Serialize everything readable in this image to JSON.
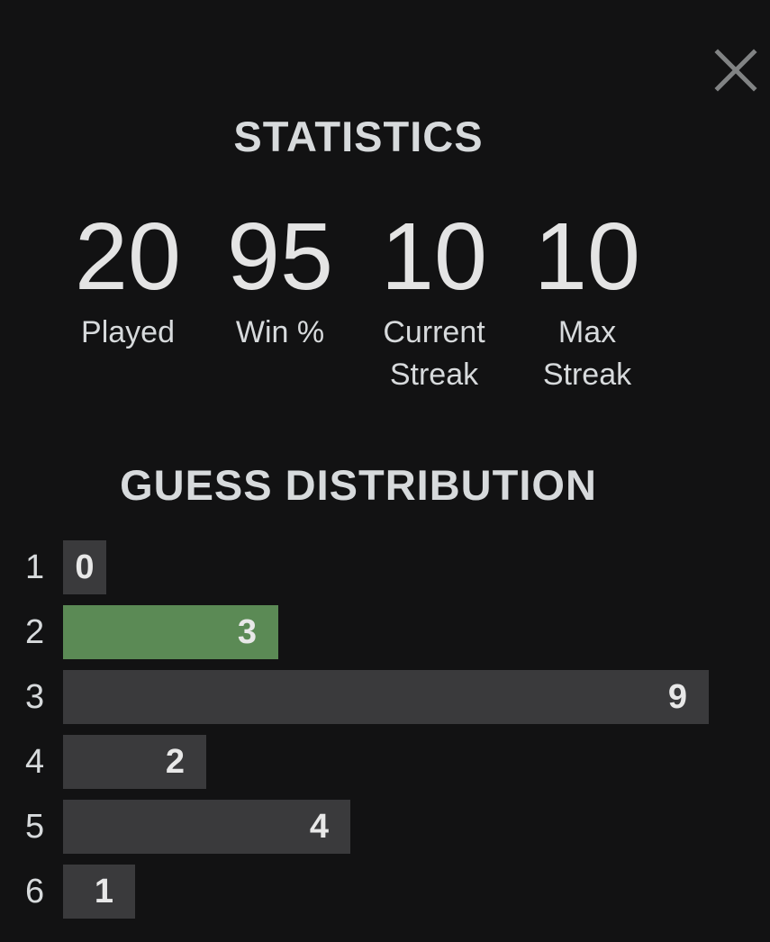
{
  "modal": {
    "close_icon": "close-icon",
    "statistics_title": "STATISTICS",
    "distribution_title": "GUESS DISTRIBUTION"
  },
  "stats": [
    {
      "value": "20",
      "label_line1": "Played",
      "label_line2": ""
    },
    {
      "value": "95",
      "label_line1": "Win %",
      "label_line2": ""
    },
    {
      "value": "10",
      "label_line1": "Current",
      "label_line2": "Streak"
    },
    {
      "value": "10",
      "label_line1": "Max",
      "label_line2": "Streak"
    }
  ],
  "colors": {
    "background": "#121213",
    "bar": "#3a3a3c",
    "bar_highlight": "#5b8a55",
    "text": "#d7dadc"
  },
  "distribution": {
    "max": 9,
    "highlight_guess": "2",
    "rows": [
      {
        "guess": "1",
        "count": 0
      },
      {
        "guess": "2",
        "count": 3
      },
      {
        "guess": "3",
        "count": 9
      },
      {
        "guess": "4",
        "count": 2
      },
      {
        "guess": "5",
        "count": 4
      },
      {
        "guess": "6",
        "count": 1
      }
    ]
  }
}
